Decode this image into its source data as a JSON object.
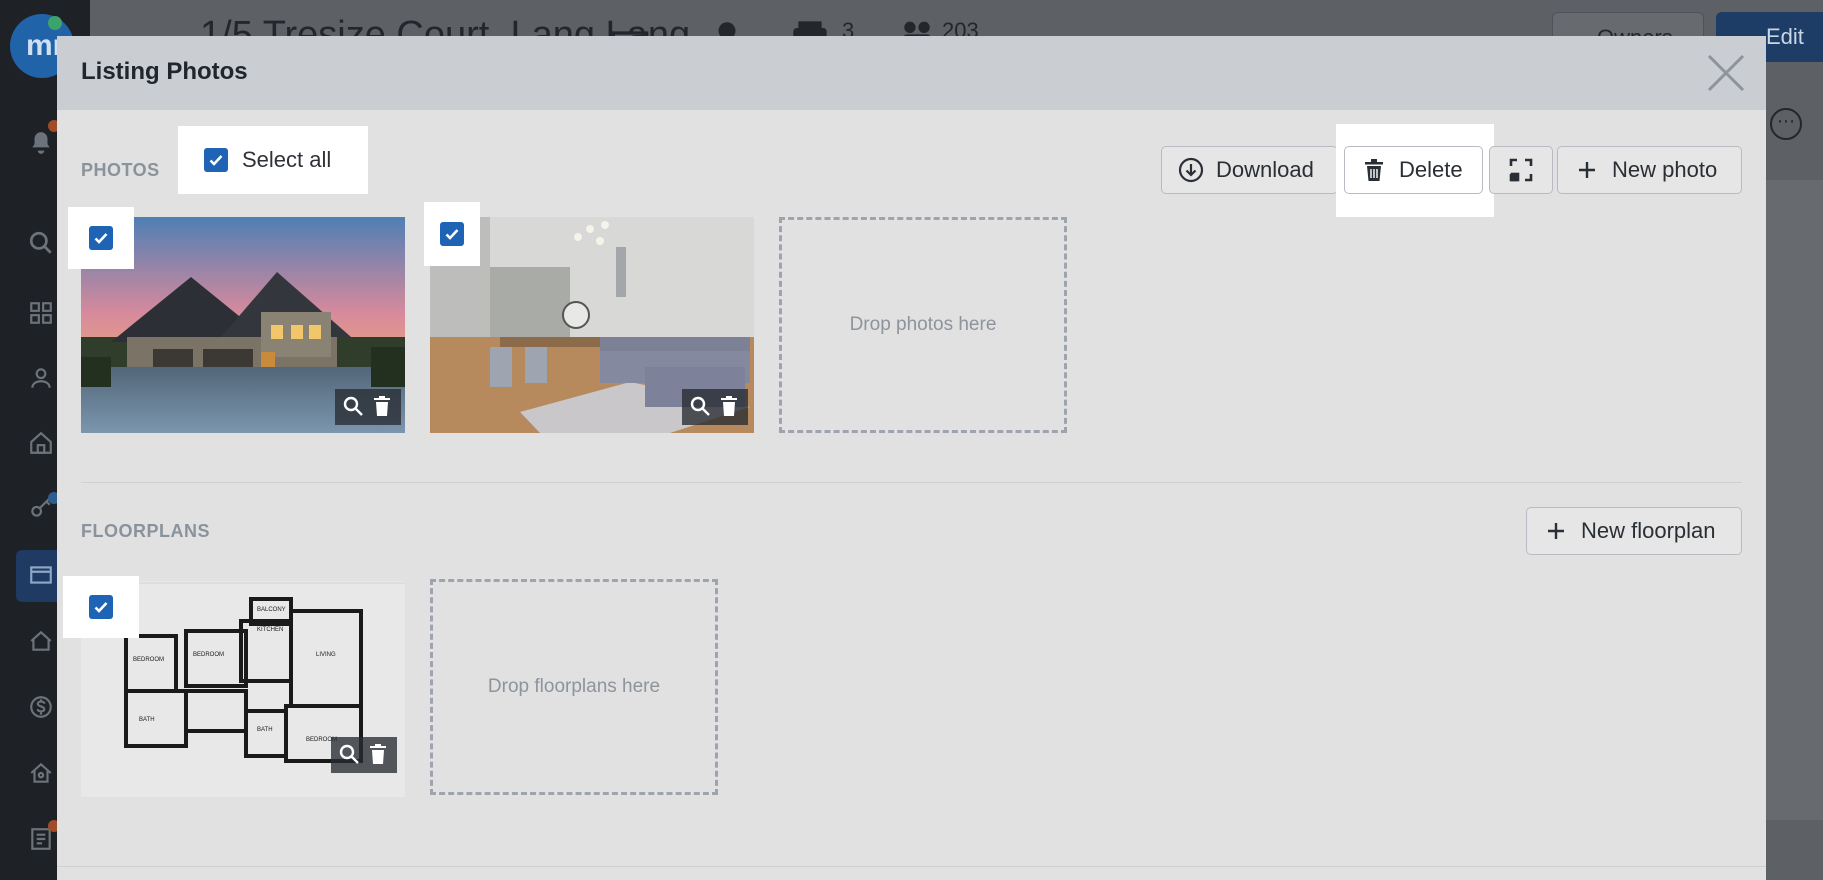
{
  "background": {
    "logo_text": "mr",
    "listing_title": "1/5 Tresize Court, Lang Lang",
    "car_spaces": "3",
    "area": "203",
    "owners_label": "Owners",
    "edit_label": "Edit"
  },
  "modal": {
    "title": "Listing Photos",
    "photos": {
      "section_label": "PHOTOS",
      "select_all_label": "Select all",
      "select_all_checked": true,
      "toolbar": {
        "download_label": "Download",
        "delete_label": "Delete",
        "fullscreen_icon": "fullscreen-icon",
        "new_photo_label": "New photo"
      },
      "items": [
        {
          "subject": "house exterior at dusk",
          "checked": true
        },
        {
          "subject": "living room interior",
          "checked": true
        }
      ],
      "dropzone_text": "Drop photos here"
    },
    "floorplans": {
      "section_label": "FLOORPLANS",
      "new_floorplan_label": "New floorplan",
      "items": [
        {
          "subject": "floor plan drawing",
          "checked": true
        }
      ],
      "dropzone_text": "Drop floorplans here"
    }
  },
  "colors": {
    "accent": "#1f63b5",
    "modal_header": "#cacdd1",
    "modal_body": "#e1e1e1",
    "edit_button": "#1d3c66"
  }
}
